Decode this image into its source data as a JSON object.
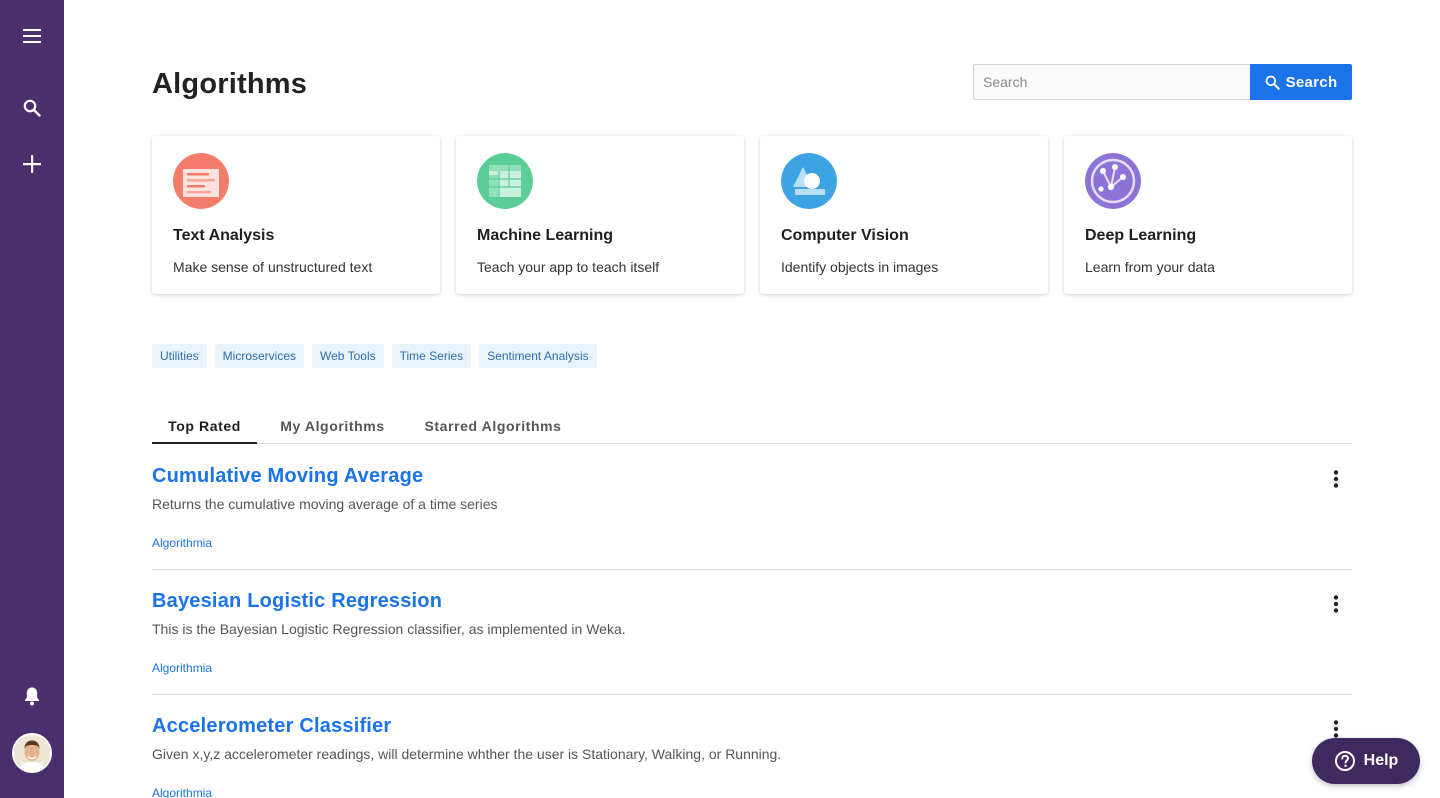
{
  "sidebar": {
    "icons": [
      "hamburger-menu-icon",
      "search-icon",
      "plus-icon",
      "bell-icon"
    ],
    "background": "#4a2f6e"
  },
  "header": {
    "title": "Algorithms",
    "search": {
      "placeholder": "Search",
      "value": "",
      "button_label": "Search"
    }
  },
  "categories": [
    {
      "title": "Text Analysis",
      "description": "Make sense of unstructured text",
      "icon": "text-analysis-icon",
      "color": "#f47c6a"
    },
    {
      "title": "Machine Learning",
      "description": "Teach your app to teach itself",
      "icon": "machine-learning-icon",
      "color": "#5ccd97"
    },
    {
      "title": "Computer Vision",
      "description": "Identify objects in images",
      "icon": "computer-vision-icon",
      "color": "#3ea3e3"
    },
    {
      "title": "Deep Learning",
      "description": "Learn from your data",
      "icon": "deep-learning-icon",
      "color": "#8b74d6"
    }
  ],
  "tags": [
    "Utilities",
    "Microservices",
    "Web Tools",
    "Time Series",
    "Sentiment Analysis"
  ],
  "tabs": [
    {
      "label": "Top Rated",
      "active": true
    },
    {
      "label": "My Algorithms",
      "active": false
    },
    {
      "label": "Starred Algorithms",
      "active": false
    }
  ],
  "algorithms": [
    {
      "title": "Cumulative Moving Average",
      "description": "Returns the cumulative moving average of a time series",
      "owner": "Algorithmia"
    },
    {
      "title": "Bayesian Logistic Regression",
      "description": "This is the Bayesian Logistic Regression classifier, as implemented in Weka.",
      "owner": "Algorithmia"
    },
    {
      "title": "Accelerometer Classifier",
      "description": "Given x,y,z accelerometer readings, will determine whther the user is Stationary, Walking, or Running.",
      "owner": "Algorithmia"
    }
  ],
  "help": {
    "label": "Help"
  },
  "colors": {
    "accent": "#1a73e8",
    "help": "#3f2a5f"
  }
}
